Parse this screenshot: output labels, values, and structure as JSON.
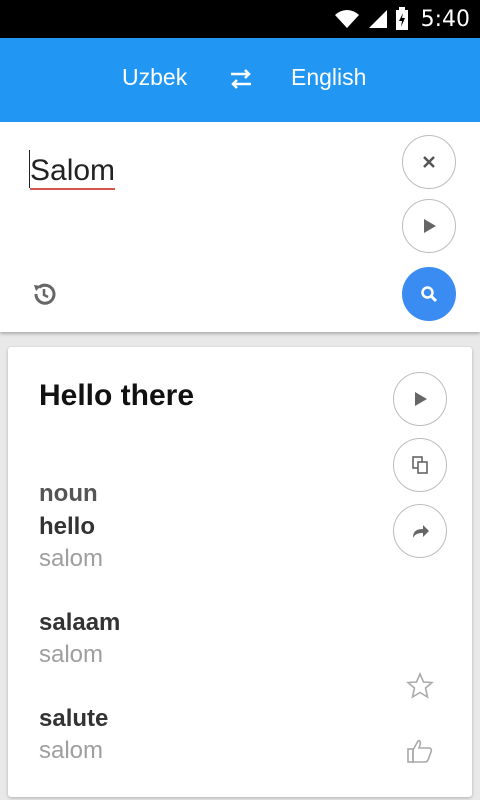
{
  "status": {
    "time": "5:40"
  },
  "header": {
    "source_lang": "English",
    "source": "Uzbek",
    "target": "English"
  },
  "input": {
    "text": "Salom"
  },
  "result": {
    "translation": "Hello there",
    "part_of_speech": "noun",
    "entries": [
      {
        "word": "hello",
        "translation": "salom"
      },
      {
        "word": "salaam",
        "translation": "salom"
      },
      {
        "word": "salute",
        "translation": "salom"
      }
    ]
  },
  "colors": {
    "appbar": "#2196f3",
    "search_button": "#3b8cf2",
    "statusbar": "#000000"
  }
}
